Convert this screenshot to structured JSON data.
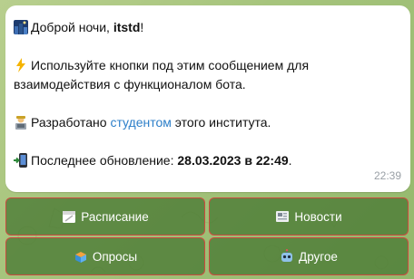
{
  "message": {
    "greeting_prefix": "Доброй ночи, ",
    "username": "itstd",
    "greeting_suffix": "!",
    "instructions": "Используйте кнопки под этим сообщением для взаимодействия с функционалом бота.",
    "dev_prefix": "Разработано ",
    "dev_link": "студентом",
    "dev_suffix": " этого института.",
    "update_prefix": "Последнее обновление: ",
    "update_value": "28.03.2023 в 22:49",
    "update_suffix": ".",
    "time": "22:39",
    "link_color": "#2d7fc9"
  },
  "keyboard": {
    "buttons": [
      {
        "label": "Расписание",
        "icon": "calendar-icon"
      },
      {
        "label": "Новости",
        "icon": "newspaper-icon"
      },
      {
        "label": "Опросы",
        "icon": "ballot-box-icon"
      },
      {
        "label": "Другое",
        "icon": "robot-icon"
      }
    ]
  }
}
